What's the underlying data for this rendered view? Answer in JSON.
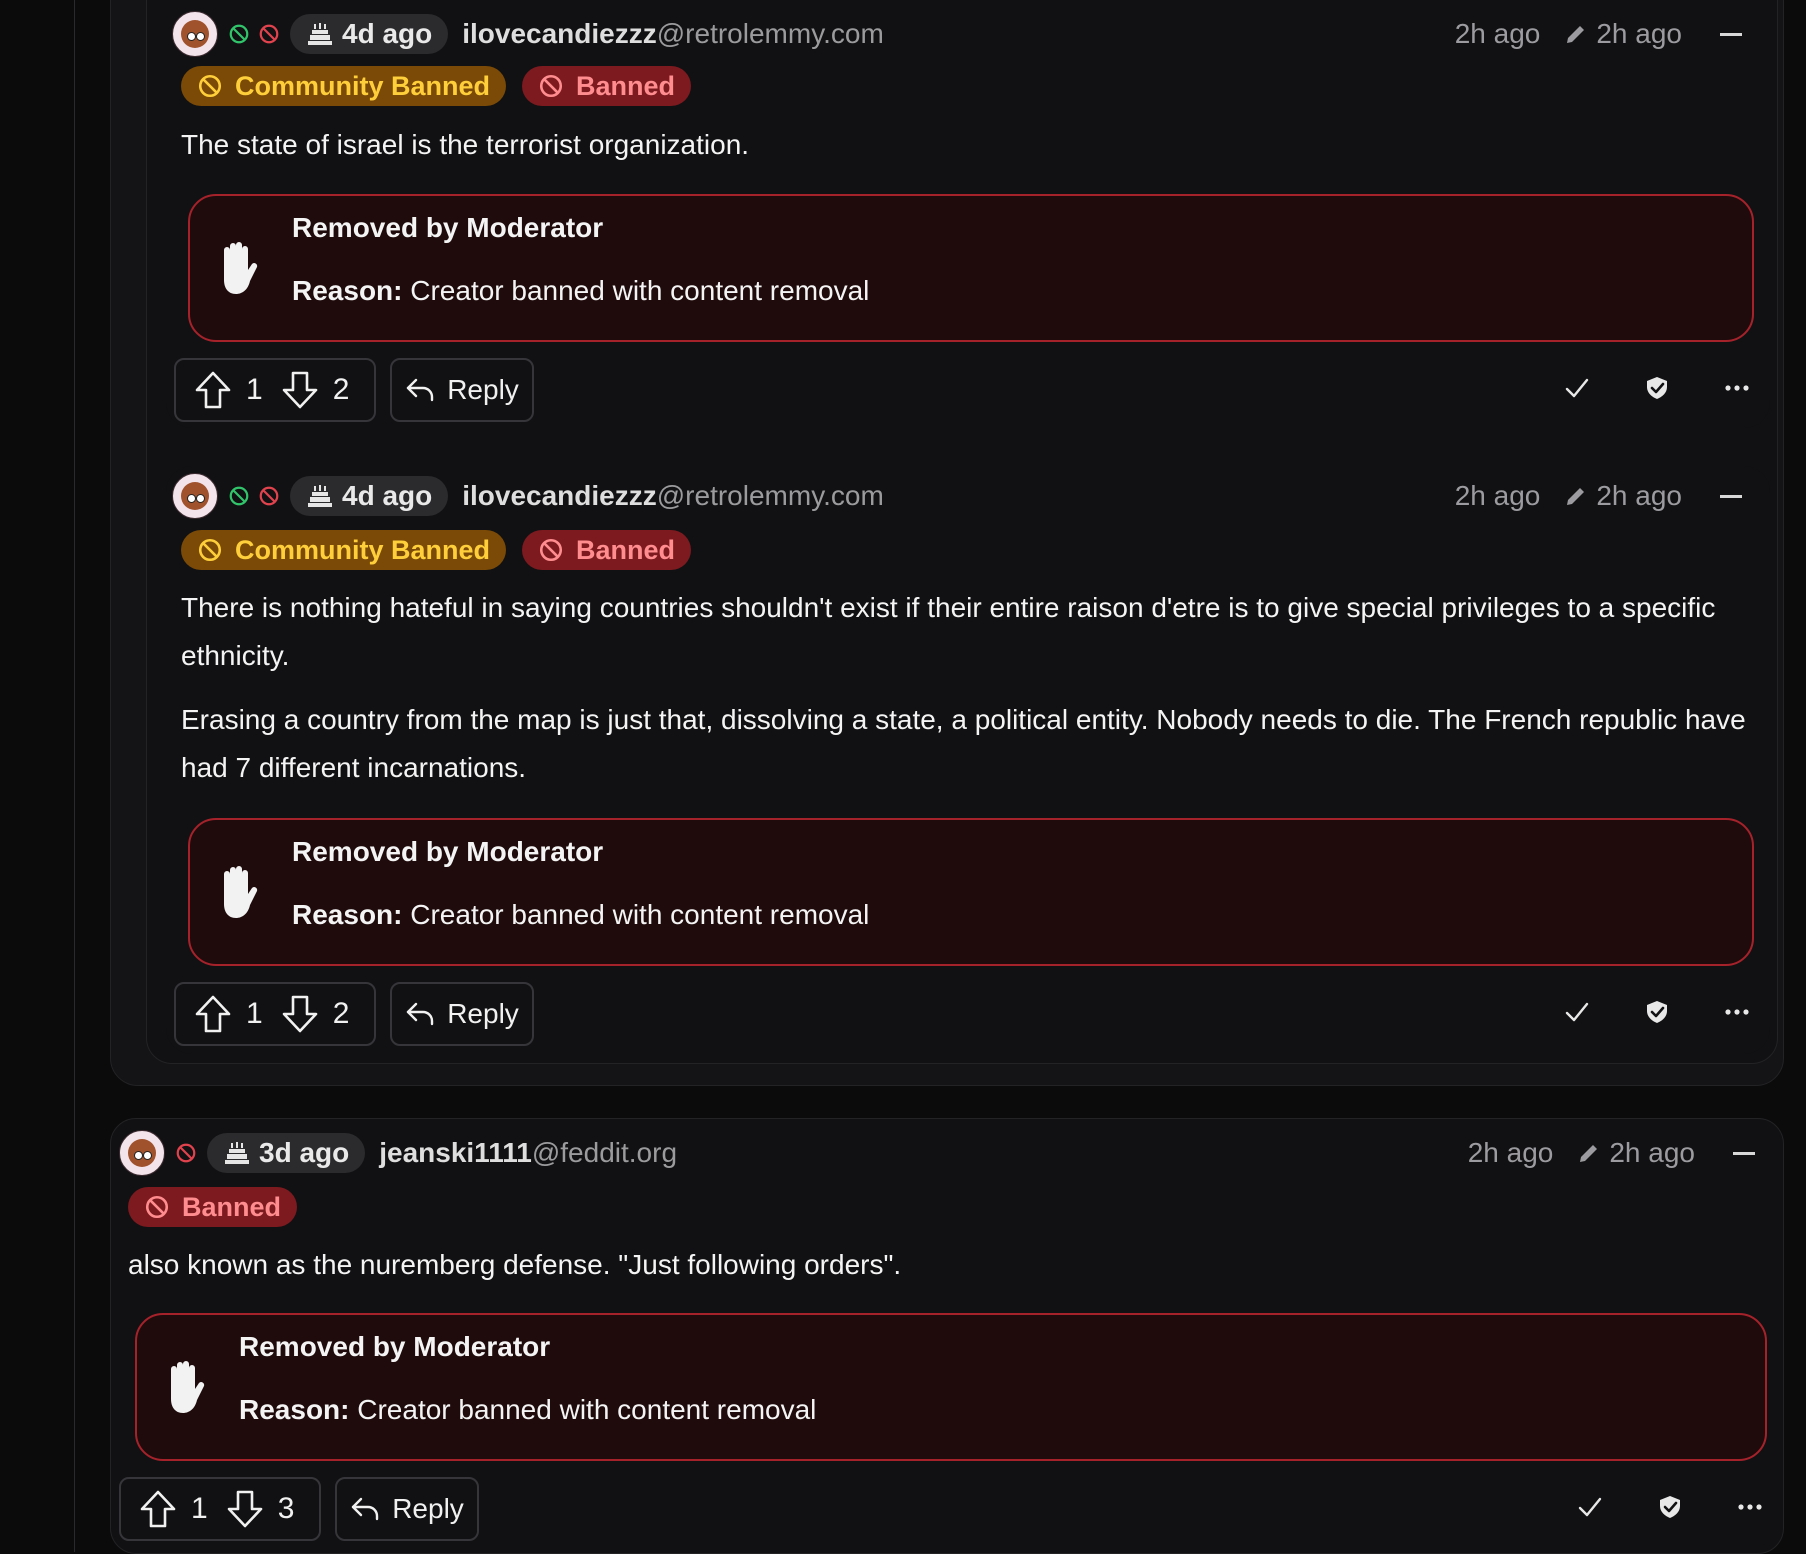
{
  "comments": [
    {
      "account_age": "4d ago",
      "username": "ilovecandiezzz",
      "instance": "@retrolemmy.com",
      "posted": "2h ago",
      "edited": "2h ago",
      "badges": [
        "Community Banned",
        "Banned"
      ],
      "paragraphs": [
        "The state of israel is the terrorist organization."
      ],
      "removed_title": "Removed by Moderator",
      "removed_reason_label": "Reason:",
      "removed_reason": "Creator banned with content removal",
      "upvotes": "1",
      "downvotes": "2",
      "reply_label": "Reply"
    },
    {
      "account_age": "4d ago",
      "username": "ilovecandiezzz",
      "instance": "@retrolemmy.com",
      "posted": "2h ago",
      "edited": "2h ago",
      "badges": [
        "Community Banned",
        "Banned"
      ],
      "paragraphs": [
        "There is nothing hateful in saying countries shouldn't exist if their entire raison d'etre is to give special privileges to a specific ethnicity.",
        "Erasing a country from the map is just that, dissolving a state, a political entity. Nobody needs to die. The French republic have had 7 different incarnations."
      ],
      "removed_title": "Removed by Moderator",
      "removed_reason_label": "Reason:",
      "removed_reason": "Creator banned with content removal",
      "upvotes": "1",
      "downvotes": "2",
      "reply_label": "Reply"
    },
    {
      "account_age": "3d ago",
      "username": "jeanski1111",
      "instance": "@feddit.org",
      "posted": "2h ago",
      "edited": "2h ago",
      "badges": [
        "Banned"
      ],
      "paragraphs": [
        "also known as the nuremberg defense. \"Just following orders\"."
      ],
      "removed_title": "Removed by Moderator",
      "removed_reason_label": "Reason:",
      "removed_reason": "Creator banned with content removal",
      "upvotes": "1",
      "downvotes": "3",
      "reply_label": "Reply"
    }
  ],
  "colors": {
    "background": "#0b0b0c",
    "community_banned_bg": "#7a4a06",
    "community_banned_text": "#ffcf3b",
    "banned_bg": "#7c1a1f",
    "banned_text": "#ff8d8f",
    "removed_border": "#a5222b"
  },
  "icons": [
    "cake-icon",
    "ban-icon",
    "pencil-icon",
    "hand-icon",
    "upvote-icon",
    "downvote-icon",
    "reply-icon",
    "check-icon",
    "shield-icon",
    "more-icon",
    "collapse-icon"
  ]
}
